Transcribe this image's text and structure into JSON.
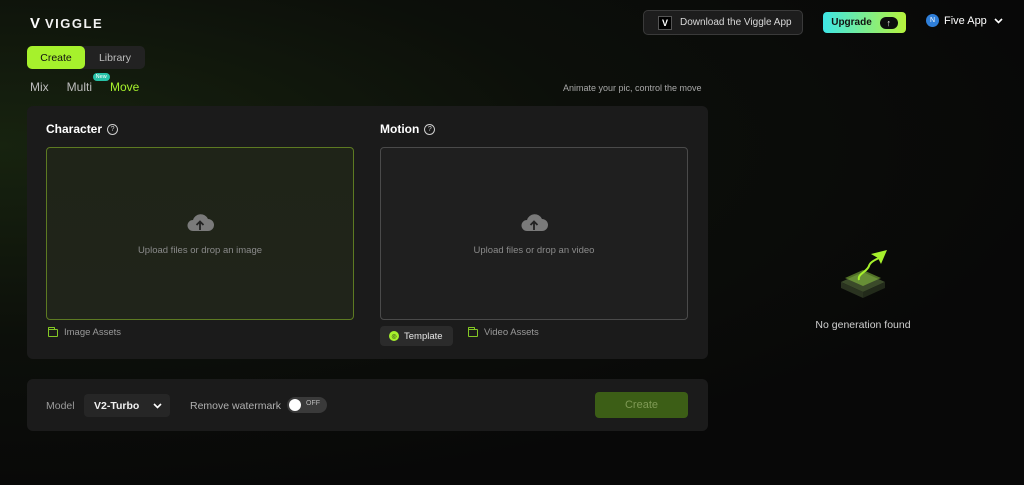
{
  "header": {
    "logo_mark": "V",
    "logo_text": "VIGGLE",
    "download_label": "Download the Viggle App",
    "upgrade_label": "Upgrade",
    "account_initial": "N",
    "account_name": "Five App"
  },
  "tabs": {
    "create": "Create",
    "library": "Library"
  },
  "modes": {
    "mix": "Mix",
    "multi": "Multi",
    "multi_badge": "New",
    "move": "Move",
    "active": "Move"
  },
  "tagline": "Animate your pic, control the move",
  "character": {
    "title": "Character",
    "upload_text": "Upload files or drop an image",
    "assets_label": "Image Assets"
  },
  "motion": {
    "title": "Motion",
    "upload_text": "Upload files or drop an video",
    "template_label": "Template",
    "assets_label": "Video Assets"
  },
  "settings": {
    "model_label": "Model",
    "model_value": "V2-Turbo",
    "watermark_label": "Remove watermark",
    "watermark_state": "OFF",
    "create_label": "Create"
  },
  "results": {
    "empty_message": "No generation found"
  },
  "colors": {
    "accent": "#a6f12c",
    "create_disabled": "#3c5e16",
    "panel": "#1b1b1b"
  }
}
